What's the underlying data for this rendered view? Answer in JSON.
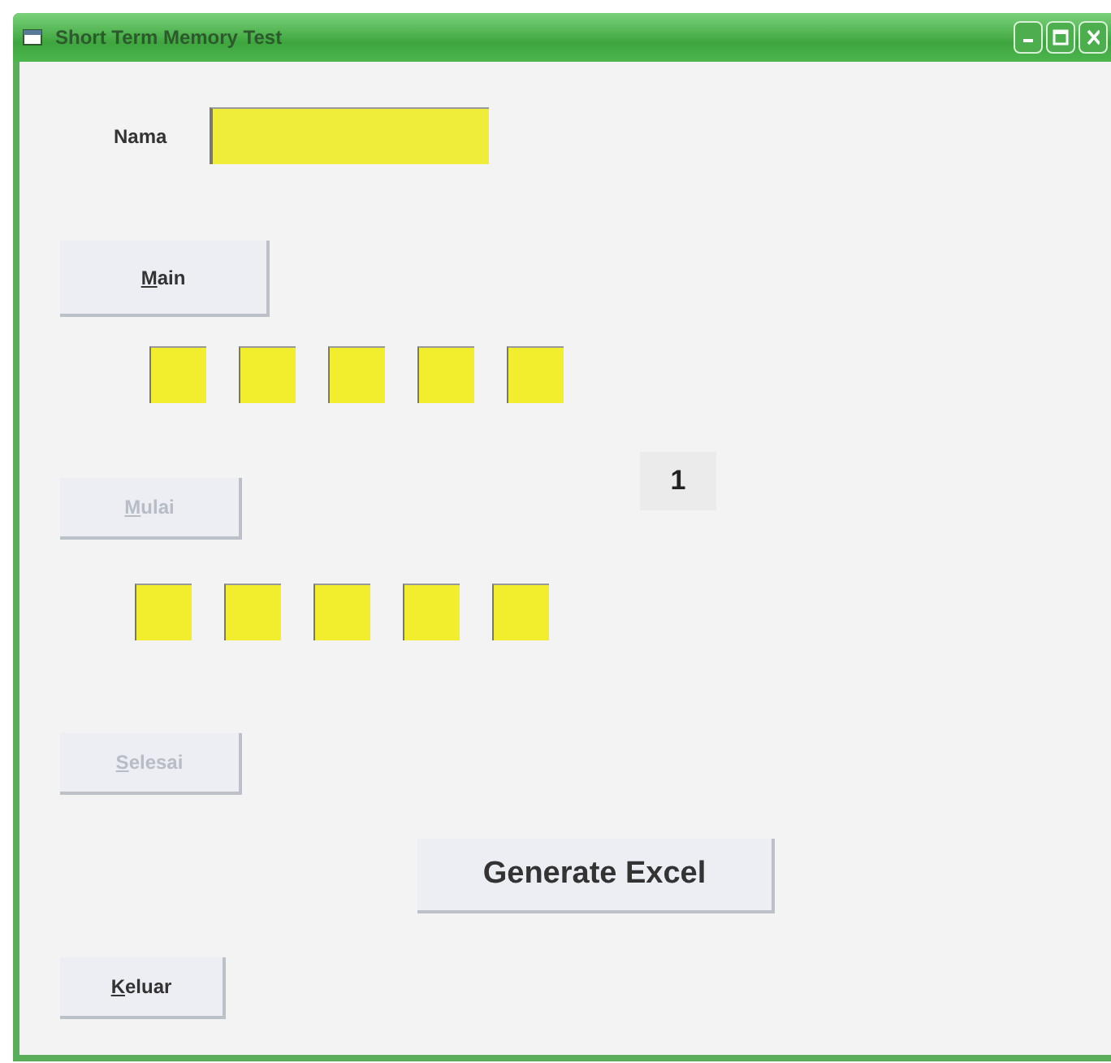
{
  "window": {
    "title": "Short Term Memory Test"
  },
  "name_field": {
    "label": "Nama"
  },
  "buttons": [
    {
      "label": "Main",
      "disabled": false,
      "mnemonic": true
    },
    {
      "label": "Mulai",
      "disabled": true,
      "mnemonic": true
    },
    {
      "label": "Selesai",
      "disabled": true,
      "mnemonic": true
    },
    {
      "label": "Generate Excel",
      "disabled": false,
      "mnemonic": false
    },
    {
      "label": "Keluar",
      "disabled": false,
      "mnemonic": true
    }
  ],
  "shown_boxes": [
    {
      "kind": "field"
    },
    {
      "kind": "field"
    },
    {
      "kind": "field"
    },
    {
      "kind": "field"
    },
    {
      "kind": "field"
    }
  ],
  "answer_boxes": [
    {
      "kind": "field"
    },
    {
      "kind": "field"
    },
    {
      "kind": "field"
    },
    {
      "kind": "field"
    },
    {
      "kind": "field"
    }
  ],
  "counter": "1"
}
